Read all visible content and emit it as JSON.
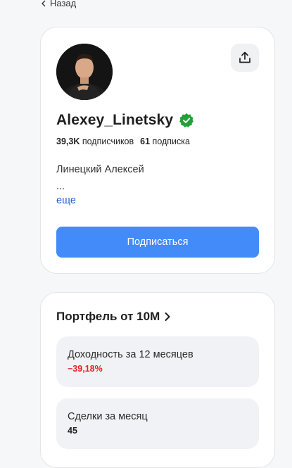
{
  "nav": {
    "back_label": "Назад"
  },
  "profile": {
    "name": "Alexey_Linetsky",
    "verified": true,
    "followers_count": "39,3K",
    "followers_label": "подписчиков",
    "following_count": "61",
    "following_label": "подписка",
    "bio_line1": "Линецкий Алексей",
    "bio_line2": "...",
    "more_label": "еще",
    "subscribe_label": "Подписаться",
    "accent_color": "#428bf9",
    "verified_color": "#21a038"
  },
  "portfolio": {
    "title": "Портфель от 10М",
    "yield_label": "Доходность за 12 месяцев",
    "yield_value": "−39,18%",
    "yield_color": "#e2252b",
    "deals_label": "Сделки за месяц",
    "deals_value": "45"
  }
}
